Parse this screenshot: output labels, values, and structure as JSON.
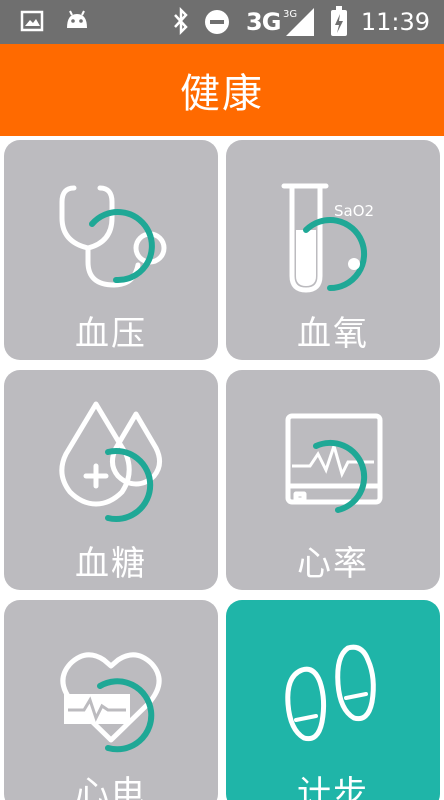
{
  "status_bar": {
    "network": "3G",
    "network_small": "3G",
    "time": "11:39"
  },
  "header": {
    "title": "健康"
  },
  "tiles": [
    {
      "label": "血压",
      "icon": "stethoscope-icon"
    },
    {
      "label": "血氧",
      "icon": "test-tube-icon",
      "icon_text": "SaO2"
    },
    {
      "label": "血糖",
      "icon": "blood-drops-icon"
    },
    {
      "label": "心率",
      "icon": "heart-rate-monitor-icon"
    },
    {
      "label": "心电",
      "icon": "heart-ecg-icon"
    },
    {
      "label": "计步",
      "icon": "footprints-icon"
    }
  ],
  "colors": {
    "header": "#ff6a00",
    "tile": "#bcbbbf",
    "tile_active": "#1fb5a8",
    "arc": "#1fa896"
  }
}
